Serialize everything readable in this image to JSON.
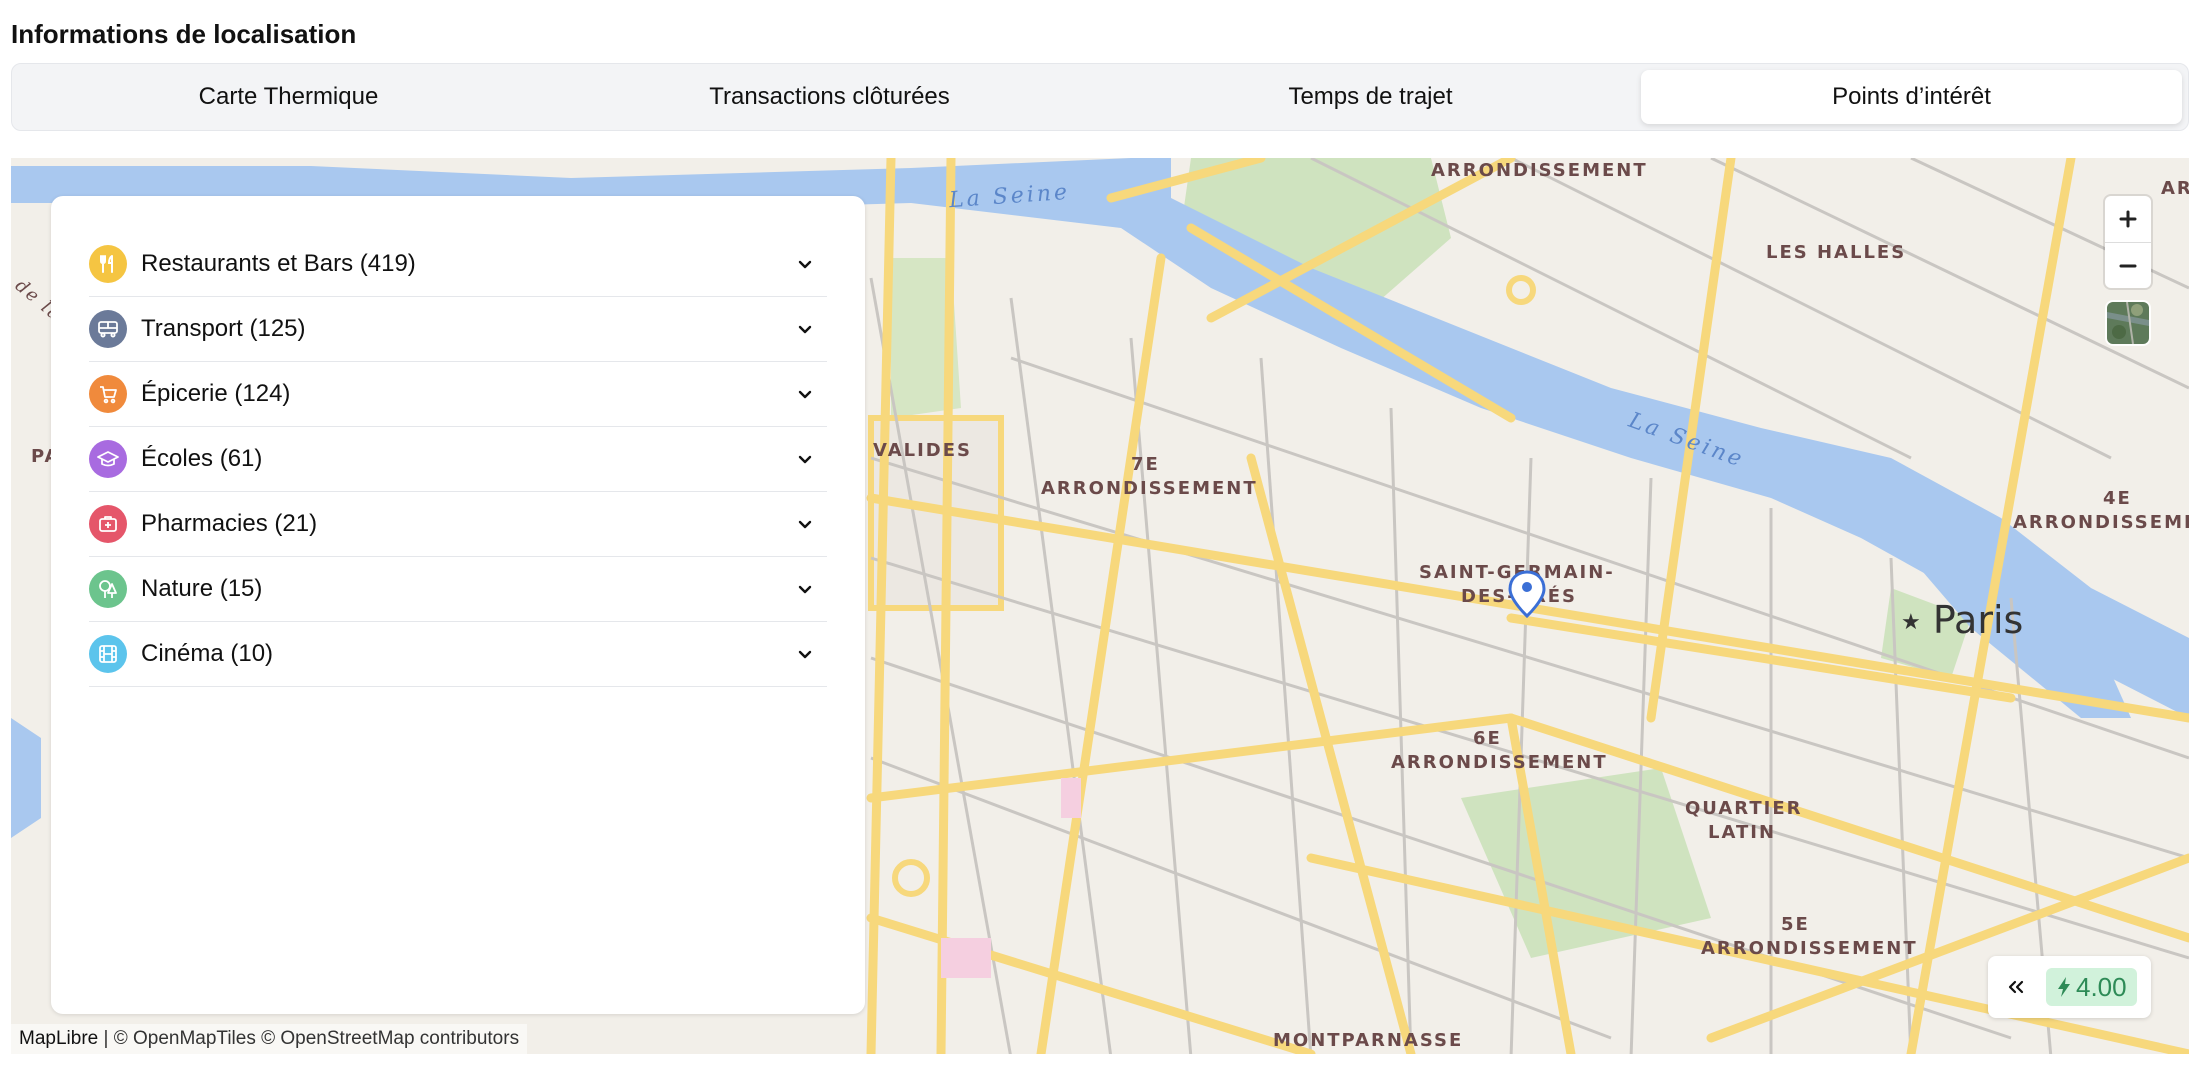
{
  "section": {
    "title": "Informations de localisation"
  },
  "tabs": [
    {
      "label": "Carte Thermique",
      "active": false
    },
    {
      "label": "Transactions clôturées",
      "active": false
    },
    {
      "label": "Temps de trajet",
      "active": false
    },
    {
      "label": "Points d’intérêt",
      "active": true
    }
  ],
  "poi": {
    "items": [
      {
        "label": "Restaurants et Bars (419)",
        "icon": "utensils-icon",
        "color": "#f5c542"
      },
      {
        "label": "Transport (125)",
        "icon": "bus-icon",
        "color": "#6b7a99"
      },
      {
        "label": "Épicerie (124)",
        "icon": "cart-icon",
        "color": "#f08a3c"
      },
      {
        "label": "Écoles (61)",
        "icon": "graduation-cap-icon",
        "color": "#a86be0"
      },
      {
        "label": "Pharmacies (21)",
        "icon": "medical-kit-icon",
        "color": "#e5566a"
      },
      {
        "label": "Nature (15)",
        "icon": "trees-icon",
        "color": "#6cc48d"
      },
      {
        "label": "Cinéma (10)",
        "icon": "film-icon",
        "color": "#5cc4ec"
      }
    ]
  },
  "map": {
    "labels": {
      "arr1_top": "ARRONDISSEMENT",
      "arr_partial_right": "ARI",
      "halles": "LES HALLES",
      "arr7_num": "7E",
      "arr7_name": "ARRONDISSEMENT",
      "invalides": "VALIDES",
      "stgermain_1": "SAINT-GERMAIN-",
      "stgermain_2": "DES-PRÉS",
      "arr6_num": "6E",
      "arr6_name": "ARRONDISSEMENT",
      "quartier_1": "QUARTIER",
      "quartier_2": "LATIN",
      "arr5_num": "5E",
      "arr5_name": "ARRONDISSEMENT",
      "arr4_num": "4E",
      "arr4_name": "ARRONDISSEMEN",
      "montparnasse": "MONTPARNASSE",
      "left_pa": "PA",
      "left_dela": "de la",
      "seine_1": "La Seine",
      "seine_2": "La Seine",
      "city": "Paris"
    },
    "attribution": {
      "brand": "MapLibre",
      "rest": " | © OpenMapTiles © OpenStreetMap contributors"
    },
    "score": "4.00",
    "colors": {
      "land": "#f2efe9",
      "water": "#a9c8ef",
      "road_major": "#f7d87c",
      "road_minor": "#c9c6c2",
      "park": "#cfe3bf",
      "marker": "#3b6fd6"
    }
  }
}
